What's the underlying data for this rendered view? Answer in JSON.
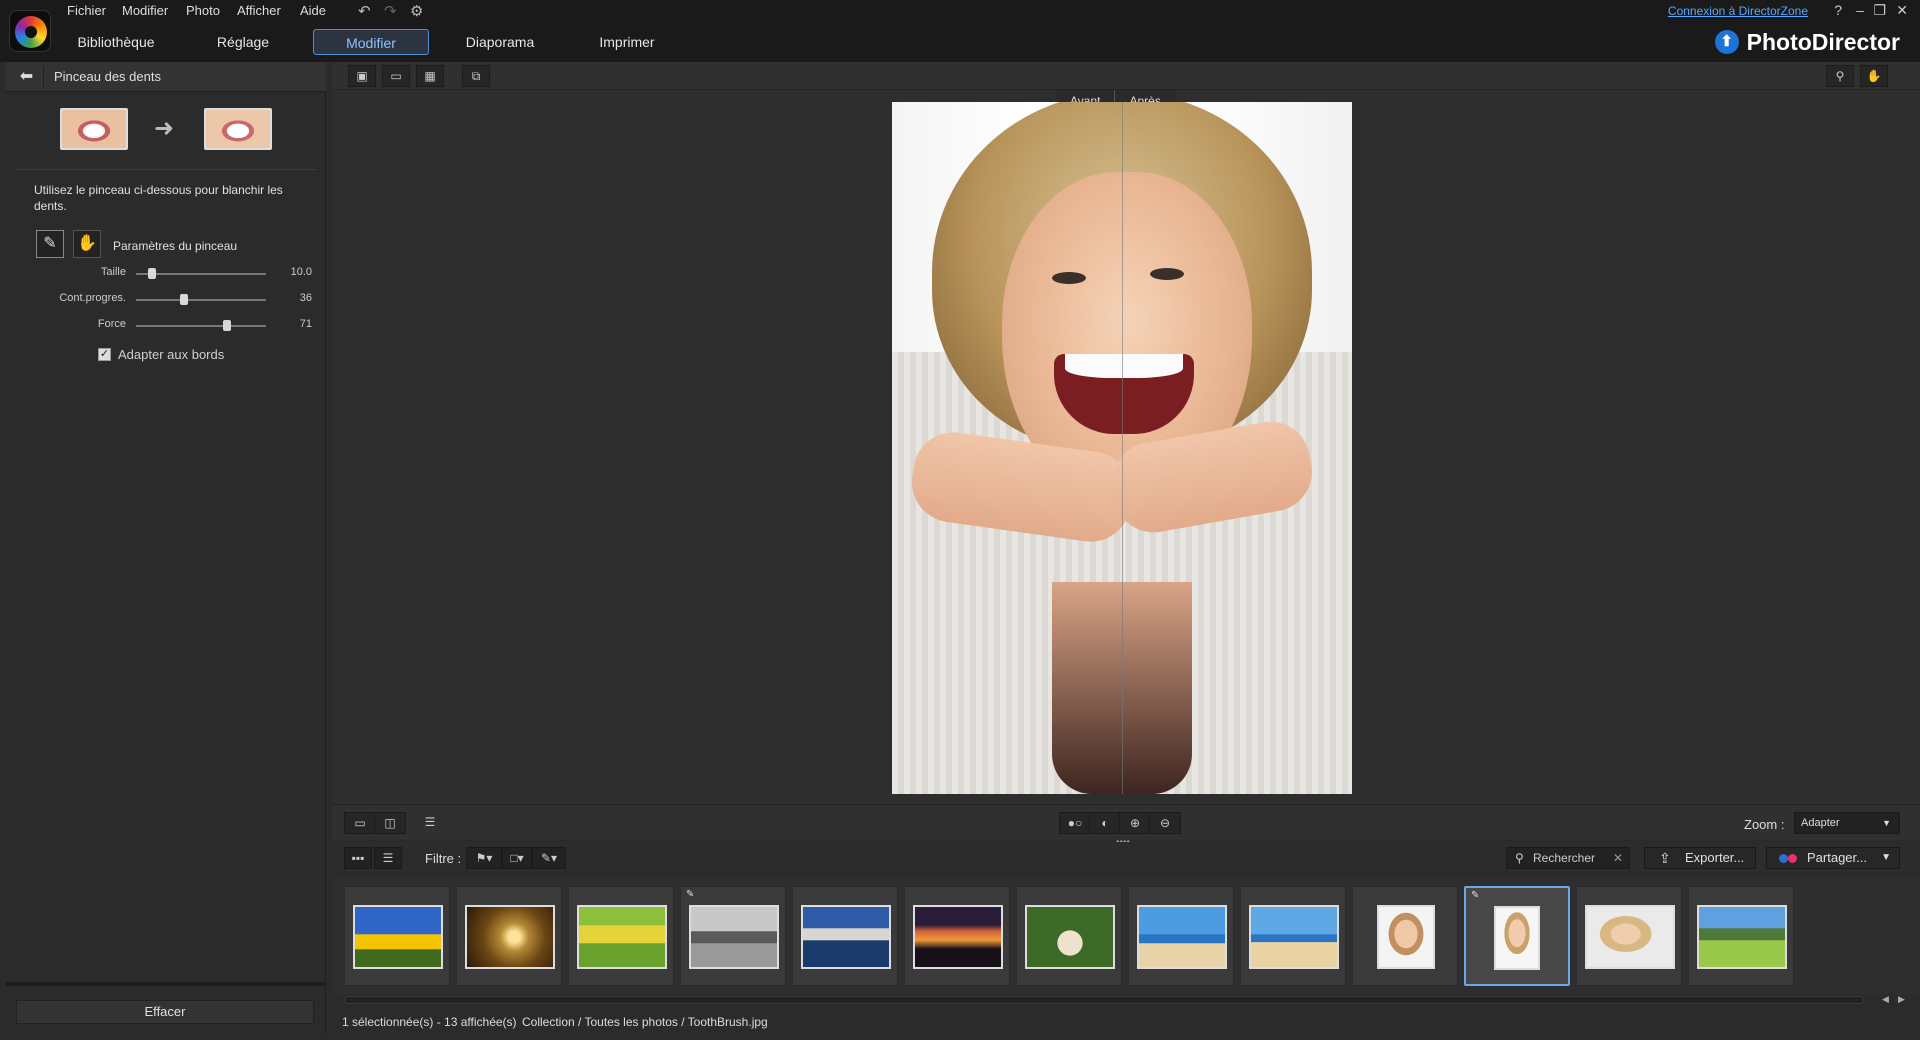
{
  "menu": [
    "Fichier",
    "Modifier",
    "Photo",
    "Afficher",
    "Aide"
  ],
  "tabs": [
    "Bibliothèque",
    "Réglage",
    "Modifier",
    "Diaporama",
    "Imprimer"
  ],
  "active_tab": "Modifier",
  "topbar": {
    "login_link": "Connexion à DirectorZone",
    "help": "?",
    "brand": "PhotoDirector"
  },
  "left_panel": {
    "title": "Pinceau des dents",
    "instruction": "Utilisez le pinceau ci-dessous pour blanchir les dents.",
    "brush_params_label": "Paramètres du pinceau",
    "sliders": [
      {
        "label": "Taille",
        "value": "10.0",
        "fraction": 0.1
      },
      {
        "label": "Cont.progres.",
        "value": "36",
        "fraction": 0.36
      },
      {
        "label": "Force",
        "value": "71",
        "fraction": 0.71
      }
    ],
    "checkbox_label": "Adapter aux bords",
    "checkbox_checked": true,
    "clear_button": "Effacer"
  },
  "viewer": {
    "before_label": "Avant",
    "after_label": "Après",
    "zoom_label": "Zoom :",
    "zoom_value": "Adapter"
  },
  "filmstrip": {
    "filter_label": "Filtre :",
    "search_placeholder": "Rechercher",
    "export_label": "Exporter...",
    "share_label": "Partager...",
    "thumbnails": [
      {
        "name": "sunflower",
        "edited": false
      },
      {
        "name": "spiral-shell",
        "edited": false
      },
      {
        "name": "bicycle-field",
        "edited": false
      },
      {
        "name": "boat-bw",
        "edited": true
      },
      {
        "name": "lake-mountain",
        "edited": false
      },
      {
        "name": "sunset",
        "edited": false
      },
      {
        "name": "cat",
        "edited": false
      },
      {
        "name": "beach-couple",
        "edited": false
      },
      {
        "name": "beach-couple-2",
        "edited": false
      },
      {
        "name": "woman-smiling",
        "edited": false
      },
      {
        "name": "woman-toothbrush",
        "edited": true,
        "selected": true
      },
      {
        "name": "woman-portrait",
        "edited": false
      },
      {
        "name": "meadow-landscape",
        "edited": false
      }
    ]
  },
  "status": {
    "count": "1 sélectionnée(s) - 13 affichée(s)",
    "path": "Collection / Toutes les photos / ToothBrush.jpg"
  },
  "colors": {
    "accent": "#4d8fd6",
    "link": "#5aa8ff",
    "selected_border": "#6aa9e8"
  }
}
